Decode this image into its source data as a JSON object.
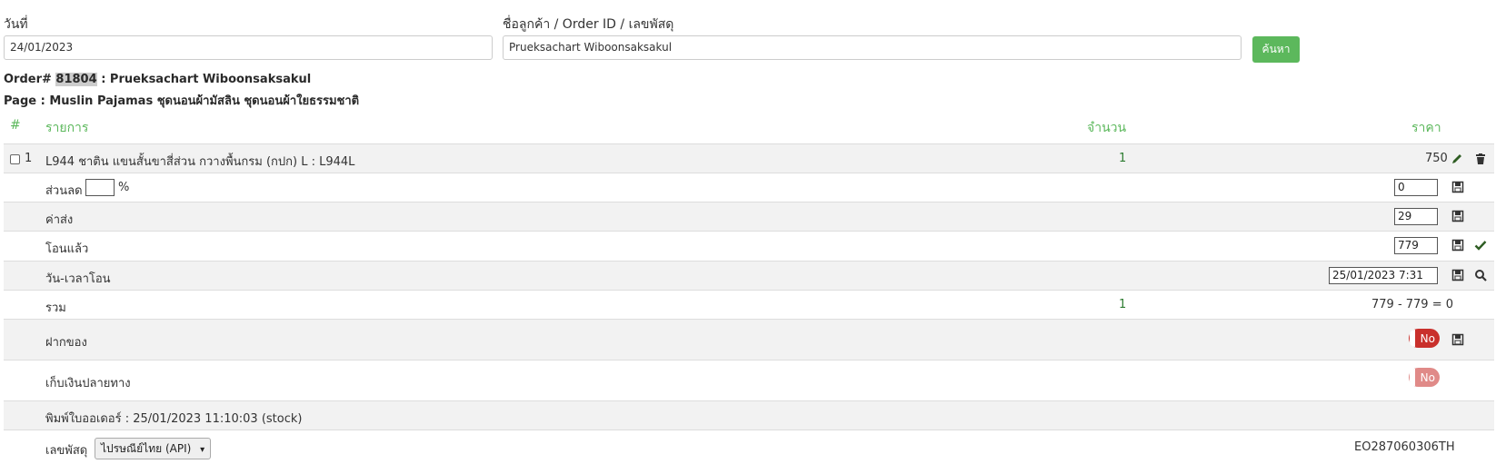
{
  "filters": {
    "date_label": "วันที่",
    "date_value": "24/01/2023",
    "customer_label": "ชื่อลูกค้า / Order ID / เลขพัสดุ",
    "customer_value": "Prueksachart Wiboonsaksakul",
    "search_button": "ค้นหา"
  },
  "order": {
    "prefix": "Order#",
    "id": "81804",
    "separator": ": Prueksachart Wiboonsaksakul",
    "page_line": "Page : Muslin Pajamas ชุดนอนผ้ามัสลิน ชุดนอนผ้าใยธรรมชาติ"
  },
  "table": {
    "headers": {
      "num": "#",
      "item": "รายการ",
      "qty": "จำนวน",
      "price": "ราคา"
    },
    "item": {
      "num": "1",
      "name": "L944 ชาติน แขนสั้นขาสี่ส่วน กวางพื้นกรม (กปก) L : L944L",
      "qty": "1",
      "price": "750"
    },
    "discount": {
      "label": "ส่วนลด",
      "percent_value": "",
      "percent_sign": "%",
      "value": "0"
    },
    "shipping": {
      "label": "ค่าส่ง",
      "value": "29"
    },
    "paid": {
      "label": "โอนแล้ว",
      "value": "779"
    },
    "transfer_time": {
      "label": "วัน-เวลาโอน",
      "value": "25/01/2023 7:31"
    },
    "total": {
      "label": "รวม",
      "qty": "1",
      "value": "779 - 779 = 0"
    },
    "deposit": {
      "label": "ฝากของ",
      "toggle": "No"
    },
    "cod": {
      "label": "เก็บเงินปลายทาง",
      "toggle": "No"
    },
    "printed": {
      "label": "พิมพ์ใบออเดอร์ : 25/01/2023 11:10:03 (stock)"
    },
    "tracking": {
      "label": "เลขพัสดุ",
      "carrier": "ไปรษณีย์ไทย (API)",
      "number": "EO287060306TH"
    }
  },
  "colors": {
    "accent": "#5cb85c",
    "toggle_on": "#c9302c",
    "toggle_faded": "#e08a88",
    "shade": "#f2f2f2"
  },
  "icons": [
    "pencil-icon",
    "trash-icon",
    "save-icon",
    "check-icon",
    "search-icon",
    "chevron-down-icon"
  ]
}
